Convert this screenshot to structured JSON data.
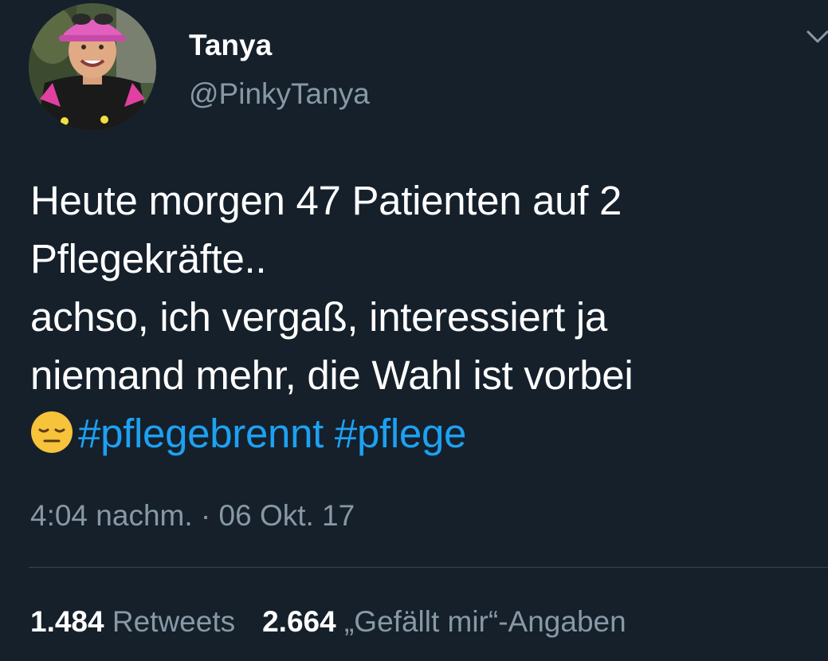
{
  "tweet": {
    "author": {
      "display_name": "Tanya",
      "handle": "@PinkyTanya"
    },
    "text_lines": [
      "Heute morgen 47 Patienten auf 2",
      "Pflegekräfte..",
      "achso, ich vergaß, interessiert ja",
      "niemand mehr, die Wahl ist vorbei"
    ],
    "emoji": "pensive-face-icon",
    "hashtags": [
      "#pflegebrennt",
      "#pflege"
    ],
    "timestamp": "4:04 nachm. · 06 Okt. 17",
    "stats": {
      "retweets_count": "1.484",
      "retweets_label": "Retweets",
      "likes_count": "2.664",
      "likes_label": "„Gefällt mir“-Angaben"
    }
  },
  "colors": {
    "background": "#15202b",
    "text": "#ffffff",
    "secondary": "#8899a6",
    "accent": "#1da1f2",
    "divider": "#38444d"
  }
}
